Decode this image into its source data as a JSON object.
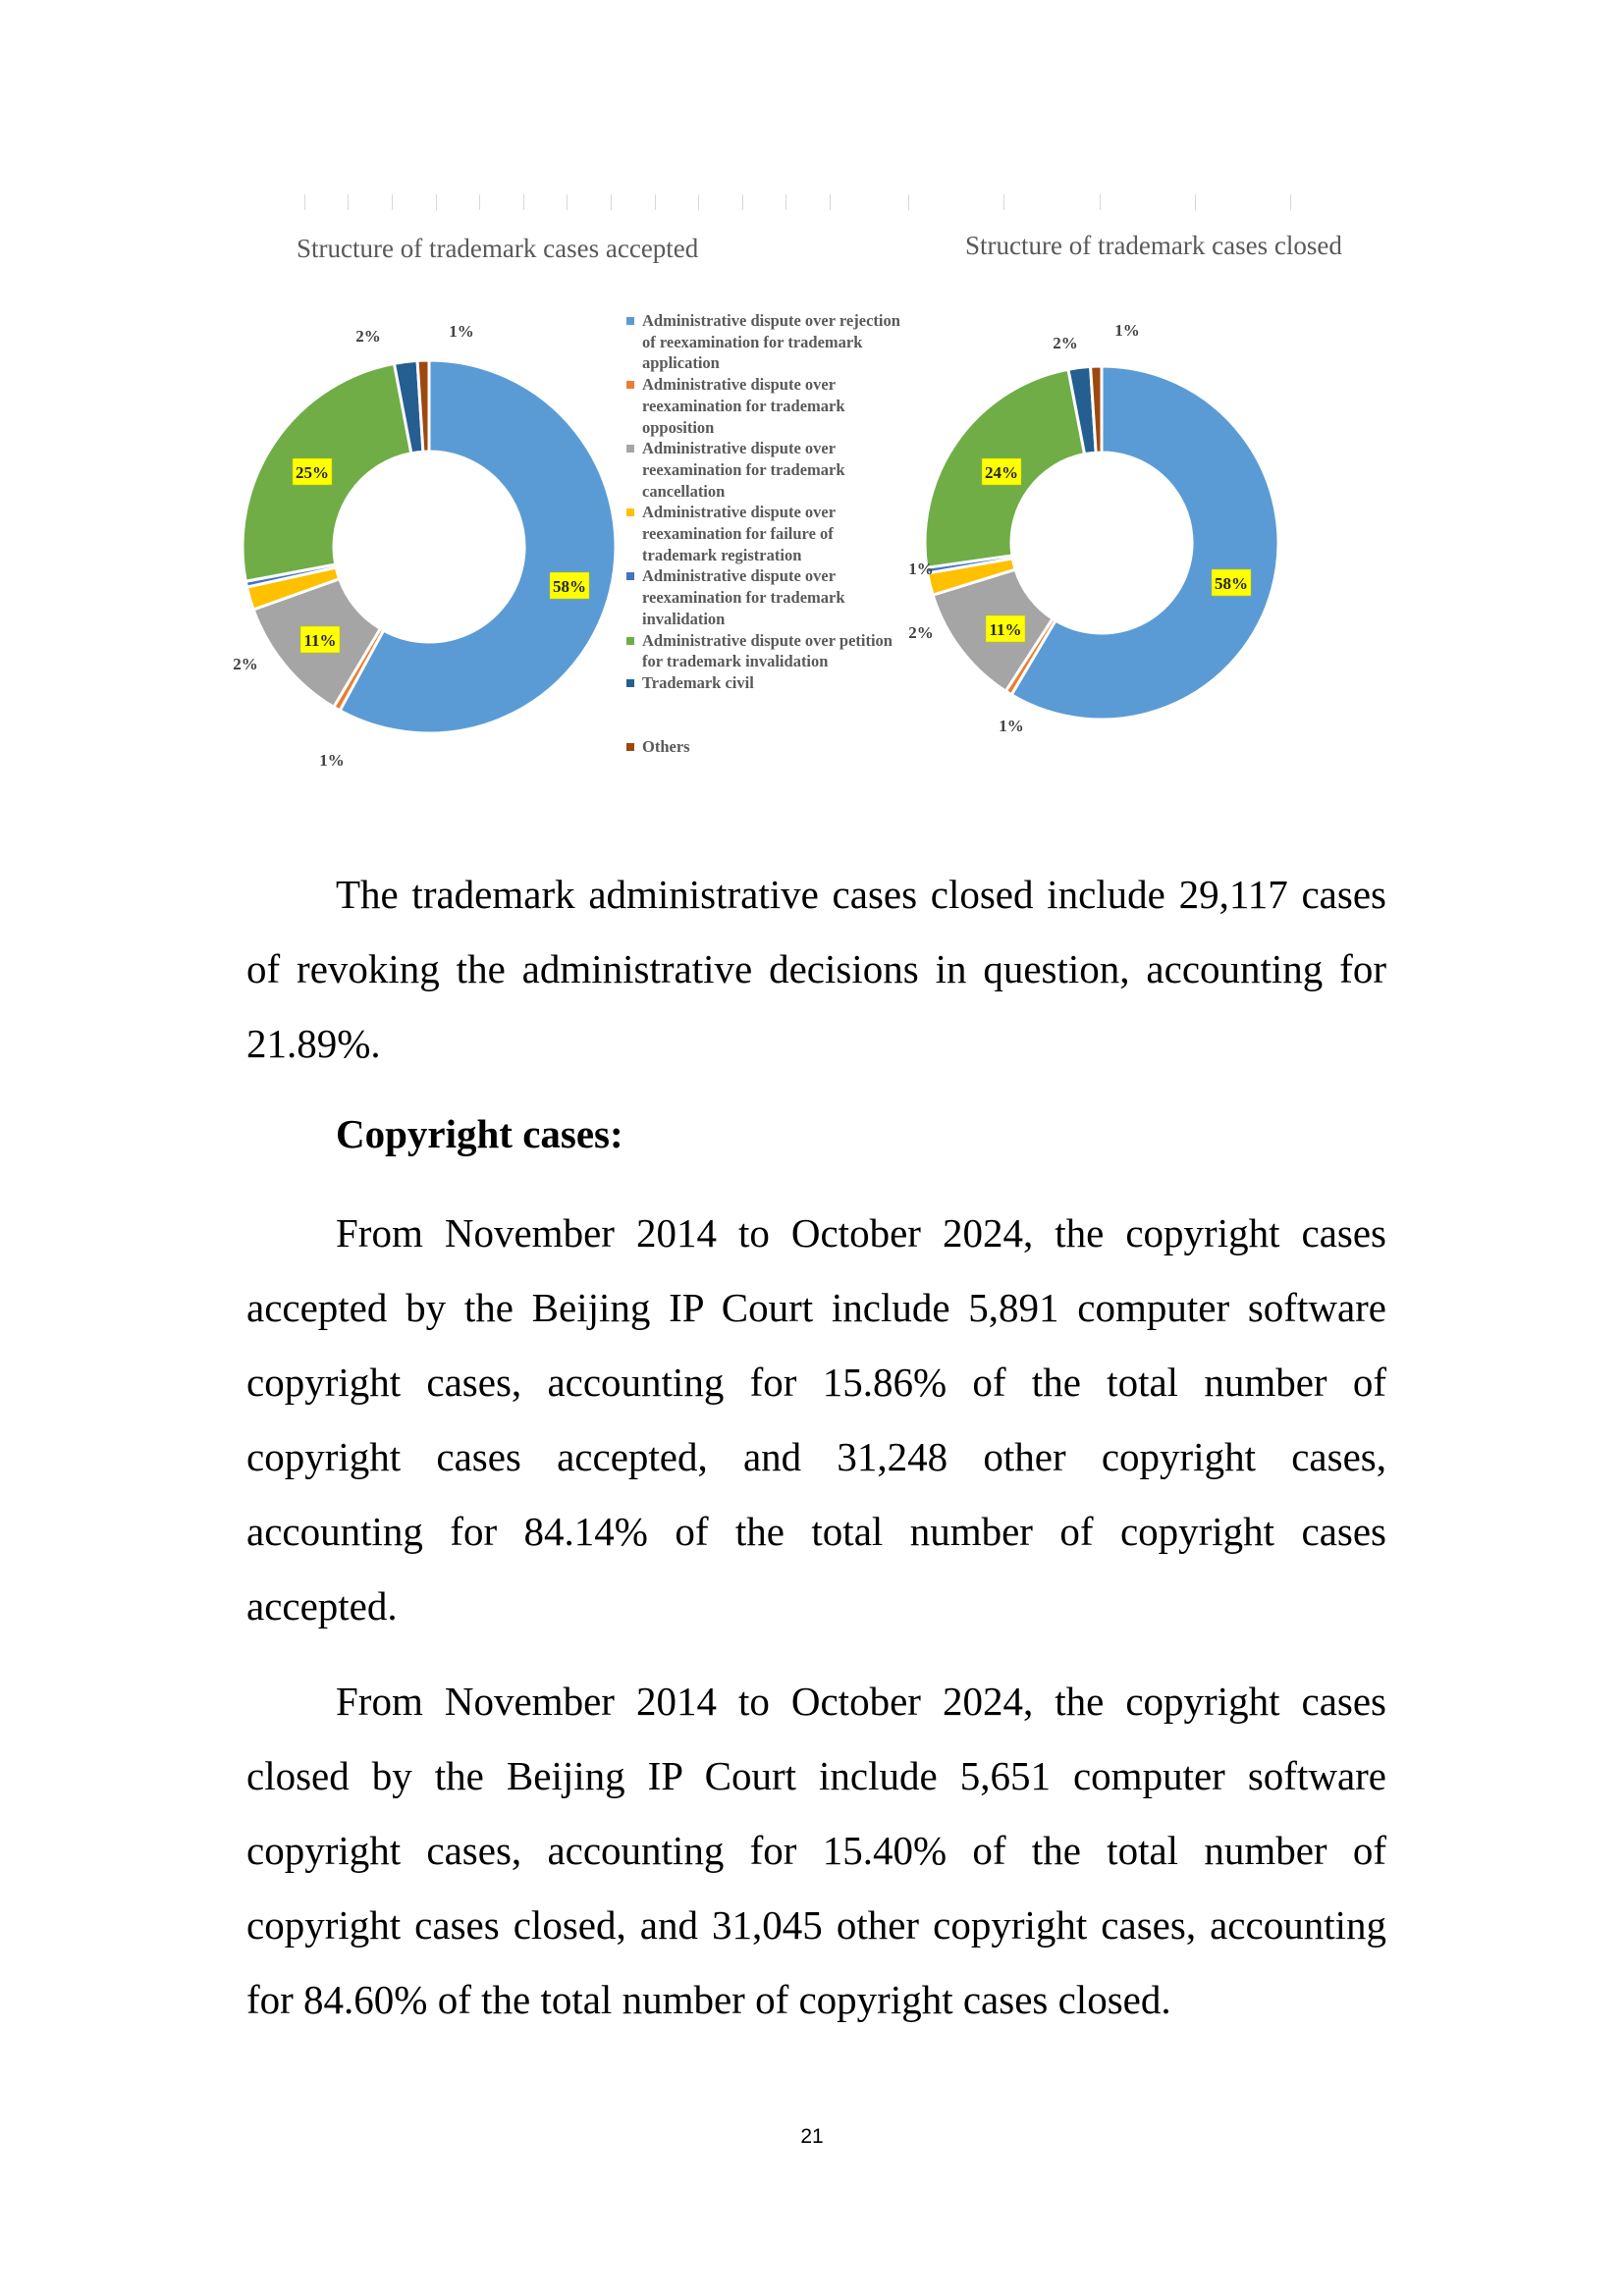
{
  "chart_data": [
    {
      "type": "pie",
      "variant": "donut",
      "title": "Structure of trademark cases accepted",
      "categories": [
        "Administrative dispute over rejection of reexamination for trademark application",
        "Administrative dispute over reexamination for trademark opposition",
        "Administrative dispute over reexamination for trademark cancellation",
        "Administrative dispute over reexamination for failure of trademark registration",
        "Administrative dispute over reexamination for trademark invalidation",
        "Administrative dispute over petition for trademark invalidation",
        "Trademark civil",
        "Others"
      ],
      "values": [
        58,
        0.6,
        11,
        2,
        0.5,
        25,
        2,
        1
      ],
      "data_labels": [
        "58%",
        "1%",
        "11%",
        "2%",
        "",
        "25%",
        "2%",
        "1%"
      ],
      "legend": "right"
    },
    {
      "type": "pie",
      "variant": "donut",
      "title": "Structure of trademark cases closed",
      "categories": [
        "Administrative dispute over rejection of reexamination for trademark application",
        "Administrative dispute over reexamination for trademark opposition",
        "Administrative dispute over reexamination for trademark cancellation",
        "Administrative dispute over reexamination for failure of trademark registration",
        "Administrative dispute over reexamination for trademark invalidation",
        "Administrative dispute over petition for trademark invalidation",
        "Trademark civil",
        "Others"
      ],
      "values": [
        58,
        0.6,
        11,
        2,
        0.5,
        24,
        2,
        1
      ],
      "data_labels": [
        "58%",
        "1%",
        "11%",
        "2%",
        "1%",
        "24%",
        "2%",
        "1%"
      ],
      "legend": "none"
    }
  ],
  "colors": [
    "#5b9bd5",
    "#ed7d31",
    "#a5a5a5",
    "#ffc000",
    "#4472c4",
    "#70ad47",
    "#255e91",
    "#9e480e"
  ],
  "legend": {
    "items": [
      "Administrative dispute over rejection of reexamination for trademark application",
      "Administrative dispute over reexamination for trademark opposition",
      "Administrative dispute over reexamination for trademark cancellation",
      "Administrative dispute over reexamination for failure of trademark registration",
      "Administrative dispute over reexamination for trademark invalidation",
      "Administrative dispute over petition for trademark invalidation",
      "Trademark civil",
      "Others"
    ]
  },
  "text": {
    "para1": "The trademark administrative cases closed include 29,117 cases of revoking the administrative decisions in question, accounting for 21.89%.",
    "heading": "Copyright cases:",
    "para2": "From November 2014 to October 2024, the copyright cases accepted by the Beijing IP Court include 5,891 computer software copyright cases, accounting for 15.86% of the total number of copyright cases accepted, and 31,248 other copyright cases, accounting for 84.14% of the total number of copyright cases accepted.",
    "para3": "From November 2014 to October 2024, the copyright cases closed by the Beijing IP Court include 5,651 computer software copyright cases, accounting for 15.40% of the total number of copyright cases closed, and 31,045 other copyright cases, accounting for 84.60% of the total number of copyright cases closed.",
    "page_number": "21"
  }
}
